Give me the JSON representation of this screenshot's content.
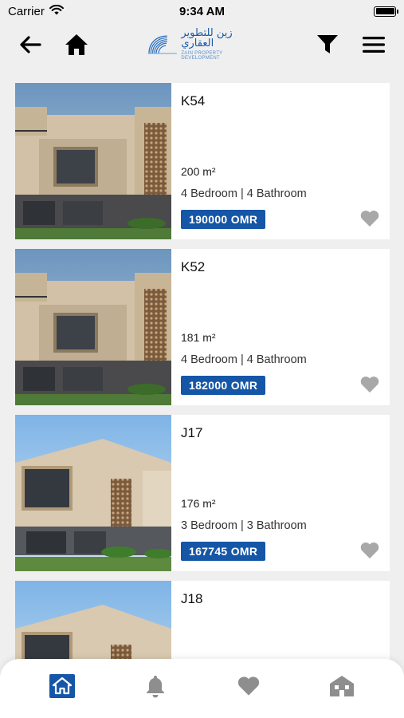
{
  "status": {
    "carrier": "Carrier",
    "time": "9:34 AM"
  },
  "header": {
    "logo_arabic": "زين للتطوير العقاري",
    "logo_english": "ZAIN PROPERTY DEVELOPMENT"
  },
  "properties": [
    {
      "title": "K54",
      "area": "200 m²",
      "rooms": "4 Bedroom | 4 Bathroom",
      "price": "190000 OMR"
    },
    {
      "title": "K52",
      "area": "181 m²",
      "rooms": "4 Bedroom | 4 Bathroom",
      "price": "182000 OMR"
    },
    {
      "title": "J17",
      "area": "176 m²",
      "rooms": "3 Bedroom | 3 Bathroom",
      "price": "167745 OMR"
    },
    {
      "title": "J18"
    }
  ],
  "colors": {
    "accent": "#1656a7",
    "tab_active": "#1656a7",
    "tab_inactive": "#8e8e8e",
    "favorite_inactive": "#a8a8a8"
  },
  "icons": {
    "back": "arrow-left-icon",
    "home": "home-icon",
    "filter": "filter-icon",
    "menu": "hamburger-menu-icon",
    "favorite": "heart-icon",
    "tabs": [
      "home-tab-icon",
      "bell-icon",
      "heart-icon",
      "building-icon"
    ]
  }
}
